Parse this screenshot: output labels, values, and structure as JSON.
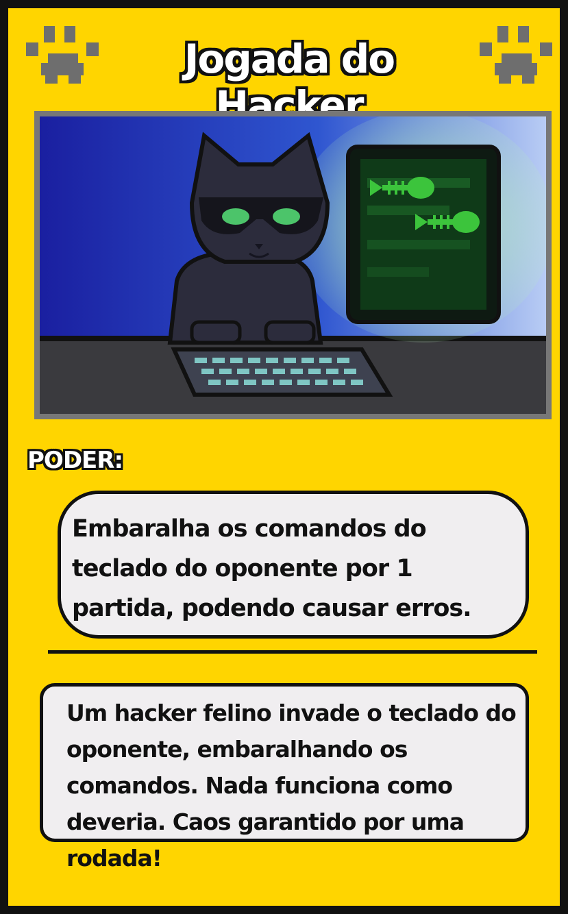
{
  "card": {
    "title": "Jogada do Hacker",
    "power_label": "PODER:",
    "power_text": "Embaralha os comandos do teclado do oponente por 1 partida, podendo causar erros.",
    "lore_text": "Um hacker felino invade o teclado do oponente, embaralhando os comandos. Nada funciona como deveria. Caos garantido por uma rodada!"
  },
  "colors": {
    "card_background": "#FFD500",
    "border": "#111111",
    "text_box": "#F0EEF0",
    "paw": "#6E6E6E",
    "screen_green": "#3CC43C"
  },
  "icons": {
    "left": "paw-icon",
    "right": "paw-icon"
  }
}
